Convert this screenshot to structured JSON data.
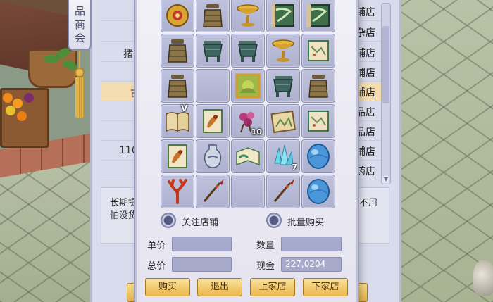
{
  "shop_sign": "品商会",
  "background_list": {
    "rows": [
      {
        "name_fragment": "",
        "suffix": "铺店"
      },
      {
        "name_fragment": "",
        "suffix": "杂店"
      },
      {
        "name_fragment": "猪",
        "suffix": "铺店"
      },
      {
        "name_fragment": "",
        "suffix": "铺店"
      },
      {
        "name_fragment": "古",
        "suffix": "铺店"
      },
      {
        "name_fragment": "",
        "suffix": "品店"
      },
      {
        "name_fragment": "",
        "suffix": "品店"
      },
      {
        "name_fragment": "110",
        "suffix": "铺店"
      },
      {
        "name_fragment": "",
        "suffix": "药店"
      }
    ],
    "description_left": "长期提",
    "description_left_2": "怕没货",
    "description_right": "不用"
  },
  "items": [
    {
      "icon": "ornate-gold-mask-icon",
      "count": "",
      "badge": ""
    },
    {
      "icon": "bronze-bell-icon",
      "count": "",
      "badge": ""
    },
    {
      "icon": "golden-chalice-icon",
      "count": "",
      "badge": ""
    },
    {
      "icon": "green-scroll-map-icon",
      "count": "",
      "badge": ""
    },
    {
      "icon": "green-scroll-map-icon",
      "count": "",
      "badge": ""
    },
    {
      "icon": "bronze-bell-icon",
      "count": "",
      "badge": ""
    },
    {
      "icon": "jade-tripod-cauldron-icon",
      "count": "",
      "badge": ""
    },
    {
      "icon": "jade-tripod-cauldron-icon",
      "count": "",
      "badge": ""
    },
    {
      "icon": "golden-chalice-icon",
      "count": "",
      "badge": ""
    },
    {
      "icon": "map-scroll-icon",
      "count": "",
      "badge": ""
    },
    {
      "icon": "bronze-bell-icon",
      "count": "",
      "badge": ""
    },
    {
      "icon": "",
      "count": "",
      "badge": ""
    },
    {
      "icon": "green-painting-icon",
      "count": "",
      "badge": ""
    },
    {
      "icon": "jade-tripod-cauldron-icon",
      "count": "",
      "badge": ""
    },
    {
      "icon": "bronze-bell-icon",
      "count": "",
      "badge": ""
    },
    {
      "icon": "open-book-icon",
      "count": "",
      "badge": "V"
    },
    {
      "icon": "beast-painting-icon",
      "count": "",
      "badge": ""
    },
    {
      "icon": "pink-flower-icon",
      "count": "10",
      "badge": ""
    },
    {
      "icon": "landscape-scroll-icon",
      "count": "",
      "badge": ""
    },
    {
      "icon": "map-scroll-icon",
      "count": "",
      "badge": ""
    },
    {
      "icon": "beast-painting-icon",
      "count": "",
      "badge": ""
    },
    {
      "icon": "porcelain-vase-icon",
      "count": "",
      "badge": ""
    },
    {
      "icon": "open-scroll-icon",
      "count": "",
      "badge": ""
    },
    {
      "icon": "blue-crystal-icon",
      "count": "7",
      "badge": ""
    },
    {
      "icon": "blue-egg-icon",
      "count": "",
      "badge": ""
    },
    {
      "icon": "red-coral-icon",
      "count": "",
      "badge": ""
    },
    {
      "icon": "spear-icon",
      "count": "",
      "badge": ""
    },
    {
      "icon": "",
      "count": "",
      "badge": ""
    },
    {
      "icon": "spear-icon",
      "count": "",
      "badge": ""
    },
    {
      "icon": "blue-egg-icon",
      "count": "",
      "badge": ""
    }
  ],
  "options": {
    "follow_shop": "关注店铺",
    "bulk_buy": "批量购买"
  },
  "fields": {
    "unit_price_label": "单价",
    "unit_price_value": "",
    "quantity_label": "数量",
    "quantity_value": "",
    "total_label": "总价",
    "total_value": "",
    "cash_label": "现金",
    "cash_value": "227,0204"
  },
  "buttons": {
    "buy": "购买",
    "exit": "退出",
    "prev_shop": "上家店",
    "next_shop": "下家店"
  },
  "colors": {
    "panel": "#e4e3ef",
    "slot": "#aeb1cf",
    "button": "#e9b74c",
    "highlight_row": "#f4ddb0"
  }
}
